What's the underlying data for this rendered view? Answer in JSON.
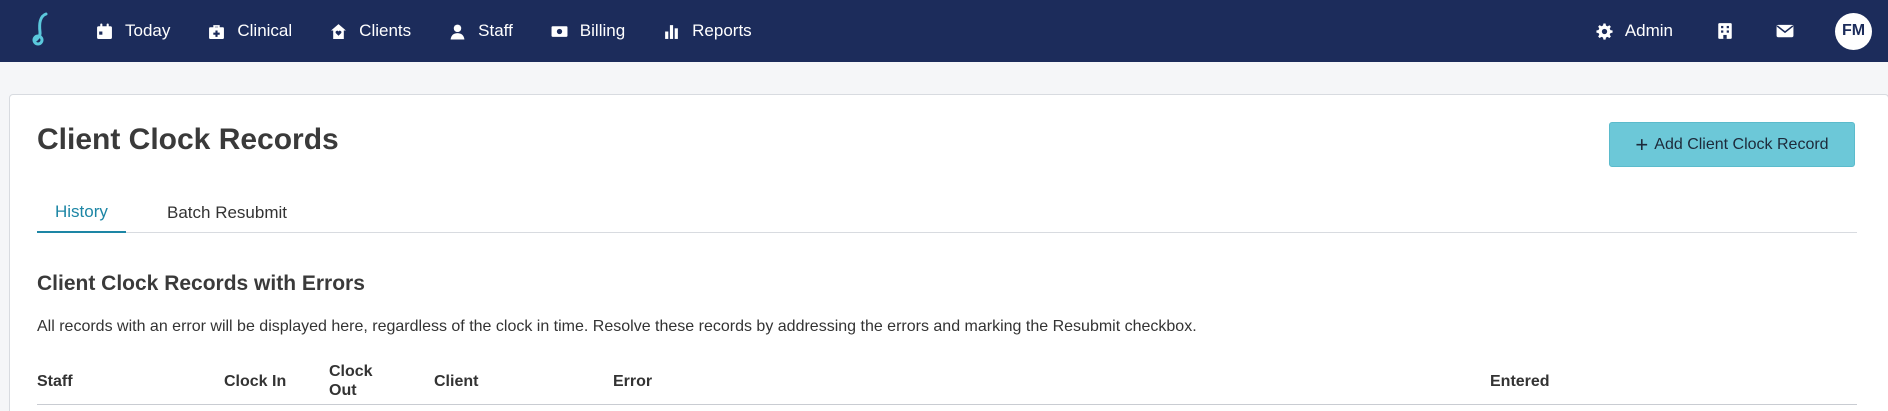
{
  "nav": {
    "items": [
      {
        "label": "Today",
        "icon": "calendar-icon"
      },
      {
        "label": "Clinical",
        "icon": "medical-kit-icon"
      },
      {
        "label": "Clients",
        "icon": "home-heart-icon"
      },
      {
        "label": "Staff",
        "icon": "staff-user-icon"
      },
      {
        "label": "Billing",
        "icon": "money-icon"
      },
      {
        "label": "Reports",
        "icon": "bar-chart-icon"
      }
    ],
    "admin_label": "Admin",
    "avatar_initials": "FM"
  },
  "page": {
    "title": "Client Clock Records",
    "add_button": "Add Client Clock Record",
    "tabs": [
      "History",
      "Batch Resubmit"
    ],
    "active_tab": "History",
    "section_title": "Client Clock Records with Errors",
    "description": "All records with an error will be displayed here, regardless of the clock in time. Resolve these records by addressing the errors and marking the Resubmit checkbox."
  },
  "table": {
    "columns": [
      "Staff",
      "Clock In",
      "Clock Out",
      "Client",
      "Error",
      "Entered"
    ]
  },
  "colors": {
    "topbar": "#1c2c5b",
    "accent": "#6cc8d8",
    "active_tab": "#1d86a5"
  }
}
